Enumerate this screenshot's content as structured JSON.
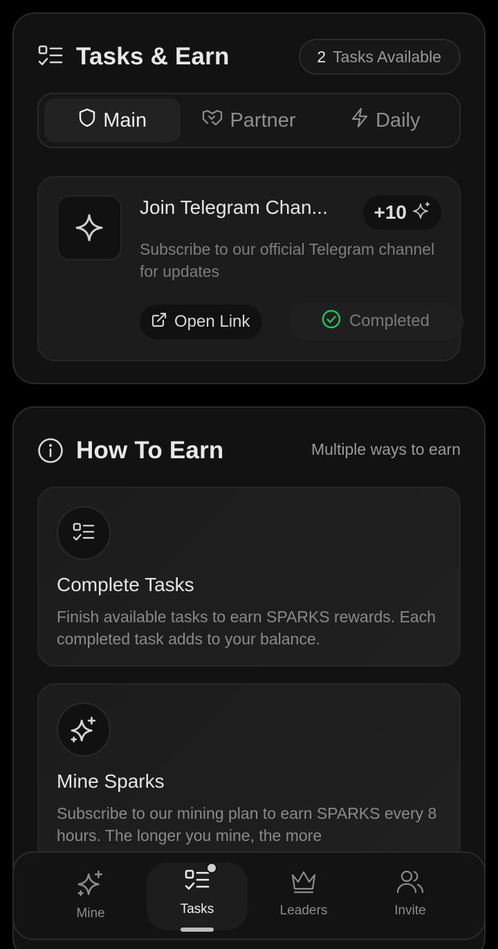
{
  "tasks_section": {
    "title": "Tasks & Earn",
    "available_count": "2",
    "available_label": "Tasks Available",
    "tabs": [
      {
        "label": "Main",
        "icon": "shield-icon",
        "active": true
      },
      {
        "label": "Partner",
        "icon": "handshake-icon",
        "active": false
      },
      {
        "label": "Daily",
        "icon": "lightning-icon",
        "active": false
      }
    ],
    "task": {
      "title": "Join Telegram Chan...",
      "reward": "+10",
      "description": "Subscribe to our official Telegram channel for updates",
      "open_link_label": "Open Link",
      "status_label": "Completed",
      "icon": "sparkle-icon"
    }
  },
  "earn_section": {
    "title": "How To Earn",
    "subtitle": "Multiple ways to earn",
    "items": [
      {
        "title": "Complete Tasks",
        "description": "Finish available tasks to earn SPARKS rewards. Each completed task adds to your balance.",
        "icon": "task-list-icon"
      },
      {
        "title": "Mine Sparks",
        "description": "Subscribe to our mining plan to earn SPARKS every 8 hours. The longer you mine, the more",
        "icon": "sparkles-icon"
      }
    ]
  },
  "bottom_nav": {
    "items": [
      {
        "label": "Mine",
        "icon": "sparkles-icon",
        "active": false
      },
      {
        "label": "Tasks",
        "icon": "task-list-icon",
        "active": true,
        "badge": true
      },
      {
        "label": "Leaders",
        "icon": "crown-icon",
        "active": false
      },
      {
        "label": "Invite",
        "icon": "users-icon",
        "active": false
      }
    ]
  },
  "colors": {
    "background": "#000000",
    "card": "#121212",
    "success": "#22c55e"
  }
}
